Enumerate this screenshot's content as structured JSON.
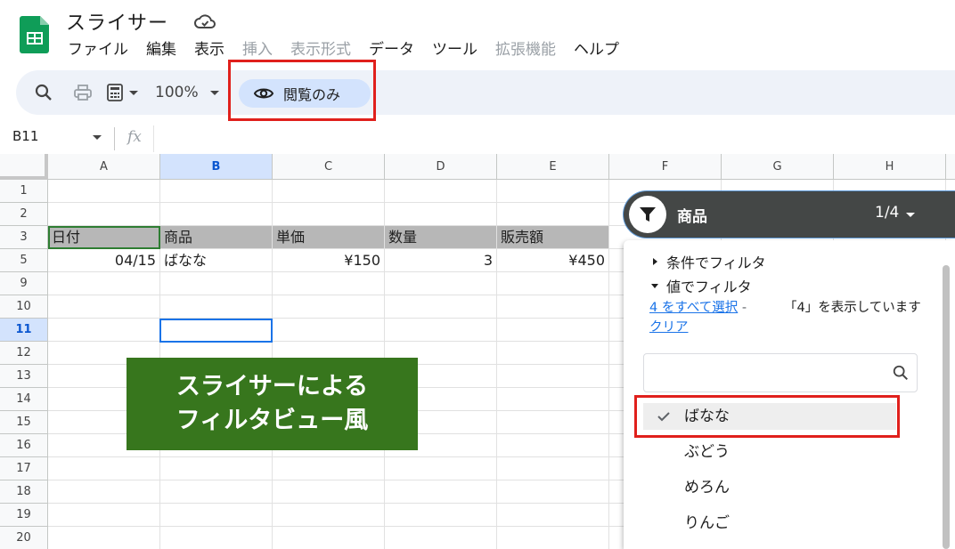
{
  "app": {
    "title": "スライサー",
    "icons": {
      "logo": "sheets-logo-icon",
      "cloud": "cloud-saved-icon"
    }
  },
  "menu": [
    {
      "label": "ファイル",
      "enabled": true
    },
    {
      "label": "編集",
      "enabled": true
    },
    {
      "label": "表示",
      "enabled": true
    },
    {
      "label": "挿入",
      "enabled": false
    },
    {
      "label": "表示形式",
      "enabled": false
    },
    {
      "label": "データ",
      "enabled": true
    },
    {
      "label": "ツール",
      "enabled": true
    },
    {
      "label": "拡張機能",
      "enabled": false
    },
    {
      "label": "ヘルプ",
      "enabled": true
    }
  ],
  "toolbar": {
    "zoom": "100%",
    "view_only_label": "閲覧のみ",
    "icons": [
      "search-icon",
      "print-icon",
      "calculator-icon",
      "chevron-down-icon",
      "eye-icon"
    ]
  },
  "formula_bar": {
    "cell_ref": "B11",
    "fx_label": "fx",
    "value": ""
  },
  "columns": [
    "A",
    "B",
    "C",
    "D",
    "E",
    "F",
    "G",
    "H"
  ],
  "selected_column": "B",
  "rows": [
    "1",
    "2",
    "3",
    "5",
    "9",
    "10",
    "11",
    "12",
    "13",
    "14",
    "15",
    "16",
    "17",
    "18",
    "19",
    "20"
  ],
  "selected_row": "11",
  "table": {
    "headers": [
      "日付",
      "商品",
      "単価",
      "数量",
      "販売額"
    ],
    "data": [
      [
        "04/15",
        "ばなな",
        "¥150",
        "3",
        "¥450"
      ]
    ]
  },
  "banner": {
    "line1": "スライサーによる",
    "line2": "フィルタビュー風",
    "color": "#37761d"
  },
  "slicer": {
    "title": "商品",
    "count": "1/4",
    "section_condition": "条件でフィルタ",
    "section_value": "値でフィルタ",
    "select_all": "4 をすべて選択",
    "separator": "-",
    "clear": "クリア",
    "showing": "「4」を表示しています",
    "search_placeholder": "",
    "options": [
      {
        "label": "ばなな",
        "checked": true
      },
      {
        "label": "ぶどう",
        "checked": false
      },
      {
        "label": "めろん",
        "checked": false
      },
      {
        "label": "りんご",
        "checked": false
      }
    ]
  },
  "colors": {
    "highlight_box": "#e0201c",
    "header_fill": "#b7b7b7",
    "selection": "#1a73e8",
    "slicer_header": "#444746"
  }
}
